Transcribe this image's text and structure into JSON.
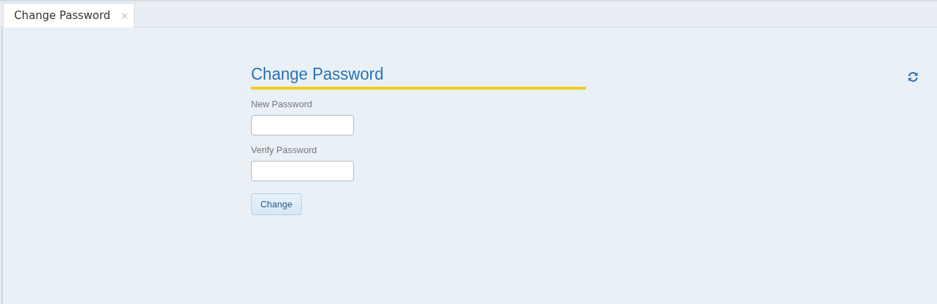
{
  "tabs": [
    {
      "label": "Change Password",
      "close": "×",
      "selected": true
    }
  ],
  "form": {
    "title": "Change Password",
    "fields": [
      {
        "label": "New Password"
      },
      {
        "label": "Verify Password"
      }
    ],
    "button": "Change"
  }
}
